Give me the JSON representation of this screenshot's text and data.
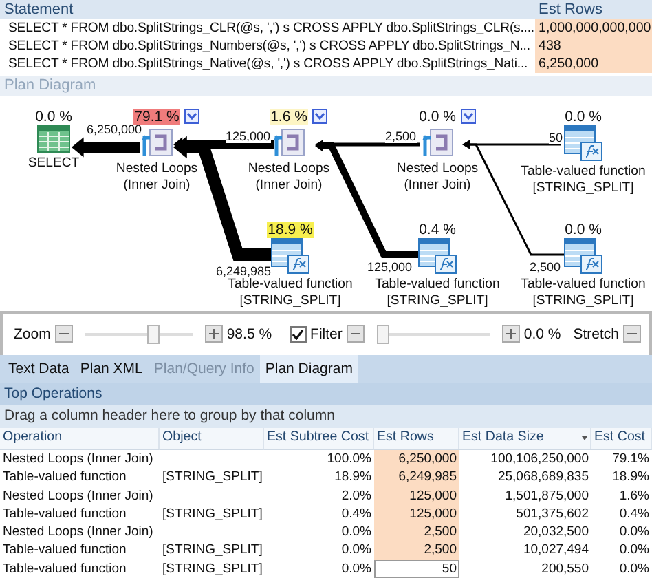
{
  "statements": {
    "columns": [
      "Statement",
      "Est Rows"
    ],
    "rows": [
      {
        "statement": "SELECT * FROM dbo.SplitStrings_CLR(@s, ',') s CROSS APPLY dbo.SplitStrings_CLR(s....",
        "est_rows": "1,000,000,000,000"
      },
      {
        "statement": "SELECT * FROM dbo.SplitStrings_Numbers(@s, ',') s CROSS APPLY dbo.SplitStrings_N...",
        "est_rows": "438"
      },
      {
        "statement": "SELECT * FROM dbo.SplitStrings_Native(@s, ',') s CROSS APPLY dbo.SplitStrings_Nati...",
        "est_rows": "6,250,000"
      }
    ]
  },
  "plan_diagram": {
    "title": "Plan Diagram",
    "nodes": [
      {
        "kind": "select",
        "cost": "0.0 %",
        "label": [
          "SELECT"
        ],
        "menu": false
      },
      {
        "kind": "nested_loops",
        "cost": "79.1 %",
        "color": "#f07c7c",
        "label": [
          "Nested Loops",
          "(Inner Join)"
        ],
        "menu": true
      },
      {
        "kind": "nested_loops",
        "cost": "1.6 %",
        "color": "#fdf5c4",
        "label": [
          "Nested Loops",
          "(Inner Join)"
        ],
        "menu": true
      },
      {
        "kind": "nested_loops",
        "cost": "0.0 %",
        "label": [
          "Nested Loops",
          "(Inner Join)"
        ],
        "menu": true
      },
      {
        "kind": "table_function",
        "cost": "0.0 %",
        "label": [
          "Table-valued function",
          "[STRING_SPLIT]"
        ],
        "menu": false
      },
      {
        "kind": "table_function",
        "cost": "18.9 %",
        "color": "#f7ef4f",
        "label": [
          "Table-valued function",
          "[STRING_SPLIT]"
        ],
        "menu": false
      },
      {
        "kind": "table_function",
        "cost": "0.4 %",
        "label": [
          "Table-valued function",
          "[STRING_SPLIT]"
        ],
        "menu": false
      },
      {
        "kind": "table_function",
        "cost": "0.0 %",
        "label": [
          "Table-valued function",
          "[STRING_SPLIT]"
        ],
        "menu": false
      }
    ],
    "edges": [
      {
        "rows": "6,250,000"
      },
      {
        "rows": "125,000"
      },
      {
        "rows": "2,500"
      },
      {
        "rows": "50"
      },
      {
        "rows": "6,249,985"
      },
      {
        "rows": "125,000"
      },
      {
        "rows": "2,500"
      }
    ]
  },
  "toolbar": {
    "zoom": {
      "label": "Zoom",
      "level": 0.65,
      "value": "98.5 %"
    },
    "filter": {
      "label": "Filter",
      "checked": true,
      "level": 0.0,
      "value": "0.0 %"
    },
    "stretch": {
      "label": "Stretch"
    }
  },
  "tabs": [
    {
      "label": "Text Data",
      "selected": false,
      "disabled": false
    },
    {
      "label": "Plan XML",
      "selected": false,
      "disabled": false
    },
    {
      "label": "Plan/Query Info",
      "selected": false,
      "disabled": true
    },
    {
      "label": "Plan Diagram",
      "selected": true,
      "disabled": false
    }
  ],
  "top_operations": {
    "title": "Top Operations",
    "group_hint": "Drag a column header here to group by that column",
    "columns": [
      {
        "label": "Operation",
        "sorted": false
      },
      {
        "label": "Object",
        "sorted": false
      },
      {
        "label": "Est Subtree Cost",
        "sorted": false
      },
      {
        "label": "Est Rows",
        "sorted": false
      },
      {
        "label": "Est Data Size",
        "sorted": true
      },
      {
        "label": "Est Cost",
        "sorted": false
      }
    ],
    "rows": [
      {
        "cells": [
          "Nested Loops (Inner Join)",
          "",
          "100.0%",
          "6,250,000",
          "100,106,250,000",
          "79.1%"
        ],
        "highlighted": true,
        "focused": false
      },
      {
        "cells": [
          "Table-valued function",
          "[STRING_SPLIT]",
          "18.9%",
          "6,249,985",
          "25,068,689,835",
          "18.9%"
        ],
        "highlighted": true,
        "focused": false
      },
      {
        "cells": [
          "Nested Loops (Inner Join)",
          "",
          "2.0%",
          "125,000",
          "1,501,875,000",
          "1.6%"
        ],
        "highlighted": true,
        "focused": false
      },
      {
        "cells": [
          "Table-valued function",
          "[STRING_SPLIT]",
          "0.4%",
          "125,000",
          "501,375,602",
          "0.4%"
        ],
        "highlighted": true,
        "focused": false
      },
      {
        "cells": [
          "Nested Loops (Inner Join)",
          "",
          "0.0%",
          "2,500",
          "20,032,500",
          "0.0%"
        ],
        "highlighted": true,
        "focused": false
      },
      {
        "cells": [
          "Table-valued function",
          "[STRING_SPLIT]",
          "0.0%",
          "2,500",
          "10,027,494",
          "0.0%"
        ],
        "highlighted": true,
        "focused": false
      },
      {
        "cells": [
          "Table-valued function",
          "[STRING_SPLIT]",
          "0.0%",
          "50",
          "200,550",
          "0.0%"
        ],
        "highlighted": false,
        "focused": true
      }
    ]
  }
}
